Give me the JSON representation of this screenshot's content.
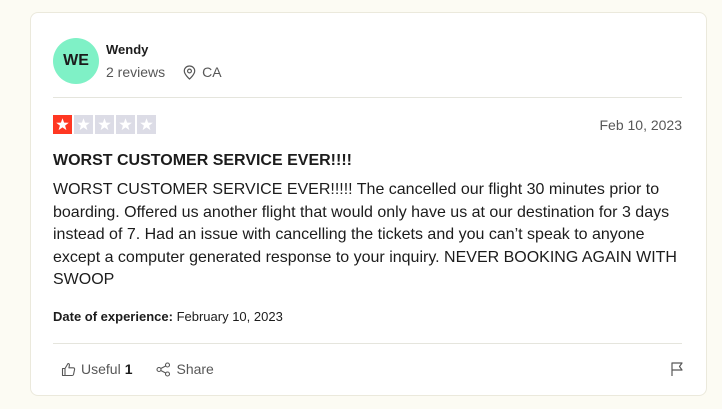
{
  "reviewer": {
    "initials": "WE",
    "name": "Wendy",
    "reviews": "2 reviews",
    "location": "CA",
    "avatar_color": "#7ff1c6"
  },
  "review": {
    "rating": 1,
    "max_rating": 5,
    "star_color_filled": "#ff3722",
    "star_color_empty": "#dcdce6",
    "date": "Feb 10, 2023",
    "title": "WORST CUSTOMER SERVICE EVER!!!!",
    "body": "WORST CUSTOMER SERVICE EVER!!!!! The cancelled our flight 30 minutes prior to boarding. Offered us another flight that would only have us at our destination for 3 days instead of 7. Had an issue with cancelling the tickets and you can’t speak to anyone except a computer generated response to your inquiry. NEVER BOOKING AGAIN WITH SWOOP",
    "experience_label": "Date of experience:",
    "experience_date": "February 10, 2023"
  },
  "actions": {
    "useful_label": "Useful",
    "useful_count": "1",
    "share_label": "Share",
    "useful_icon": "thumbs-up-icon",
    "share_icon": "share-icon",
    "flag_icon": "flag-icon"
  }
}
